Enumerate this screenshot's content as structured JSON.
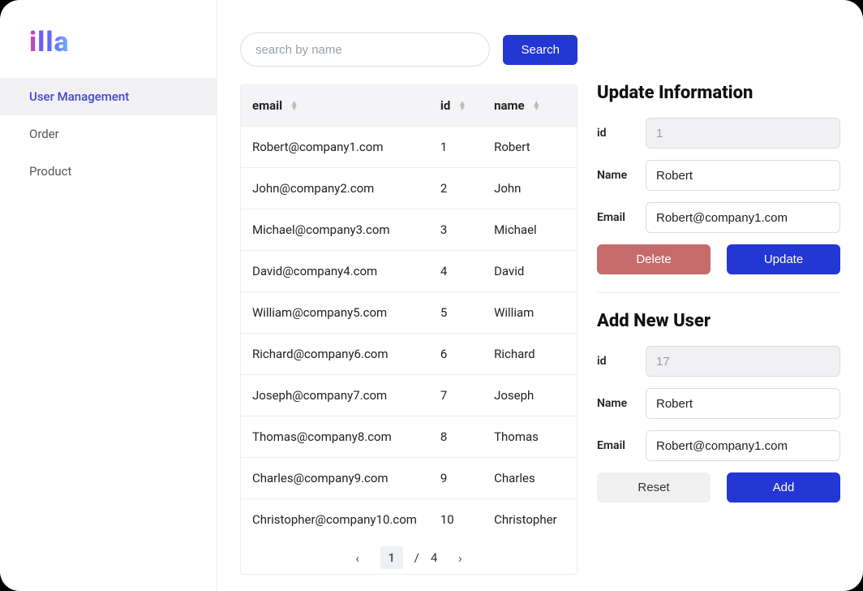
{
  "logo_text": "illa",
  "sidebar": {
    "items": [
      {
        "label": "User Management",
        "active": true
      },
      {
        "label": "Order",
        "active": false
      },
      {
        "label": "Product",
        "active": false
      }
    ]
  },
  "search": {
    "placeholder": "search by name",
    "button_label": "Search"
  },
  "table": {
    "columns": [
      {
        "key": "email",
        "label": "email"
      },
      {
        "key": "id",
        "label": "id"
      },
      {
        "key": "name",
        "label": "name"
      }
    ],
    "rows": [
      {
        "email": "Robert@company1.com",
        "id": "1",
        "name": "Robert"
      },
      {
        "email": "John@company2.com",
        "id": "2",
        "name": "John"
      },
      {
        "email": "Michael@company3.com",
        "id": "3",
        "name": "Michael"
      },
      {
        "email": "David@company4.com",
        "id": "4",
        "name": "David"
      },
      {
        "email": "William@company5.com",
        "id": "5",
        "name": "William"
      },
      {
        "email": "Richard@company6.com",
        "id": "6",
        "name": "Richard"
      },
      {
        "email": "Joseph@company7.com",
        "id": "7",
        "name": "Joseph"
      },
      {
        "email": "Thomas@company8.com",
        "id": "8",
        "name": "Thomas"
      },
      {
        "email": "Charles@company9.com",
        "id": "9",
        "name": "Charles"
      },
      {
        "email": "Christopher@company10.com",
        "id": "10",
        "name": "Christopher"
      }
    ]
  },
  "pagination": {
    "current": "1",
    "separator": "/",
    "total": "4"
  },
  "update_panel": {
    "title": "Update Information",
    "id_label": "id",
    "id_value": "1",
    "name_label": "Name",
    "name_value": "Robert",
    "email_label": "Email",
    "email_value": "Robert@company1.com",
    "delete_label": "Delete",
    "update_label": "Update"
  },
  "add_panel": {
    "title": "Add New User",
    "id_label": "id",
    "id_value": "17",
    "name_label": "Name",
    "name_value": "Robert",
    "email_label": "Email",
    "email_value": "Robert@company1.com",
    "reset_label": "Reset",
    "add_label": "Add"
  }
}
